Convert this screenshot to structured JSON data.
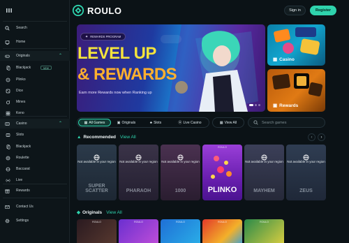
{
  "app": {
    "logo_text": "ROULO"
  },
  "header": {
    "signin_label": "Sign in",
    "register_label": "Register"
  },
  "sidebar": {
    "top": [
      {
        "label": "Search",
        "icon": "search-icon"
      },
      {
        "label": "Home",
        "icon": "home-icon"
      }
    ],
    "originals": {
      "label": "Originals",
      "icon": "gamepad-icon",
      "items": [
        {
          "label": "Blackjack",
          "badge": "NEW"
        },
        {
          "label": "Plinko"
        },
        {
          "label": "Dice"
        },
        {
          "label": "Mines"
        },
        {
          "label": "Keno"
        }
      ]
    },
    "casino": {
      "label": "Casino",
      "icon": "casino-icon",
      "items": [
        {
          "label": "Slots"
        },
        {
          "label": "Blackjack"
        },
        {
          "label": "Roulette"
        },
        {
          "label": "Baccarat"
        },
        {
          "label": "Live"
        }
      ]
    },
    "rewards": {
      "label": "Rewards"
    },
    "contact": {
      "label": "Contact Us"
    },
    "settings": {
      "label": "Settings"
    }
  },
  "hero": {
    "pill": "REWARDS PROGRAM",
    "title_line1": "LEVEL UP",
    "title_line2": "& REWARDS",
    "subtitle": "Earn more Rewards now when Ranking up"
  },
  "side_cards": {
    "casino": "Casino",
    "rewards": "Rewards"
  },
  "tabs": [
    {
      "label": "All Games",
      "active": true
    },
    {
      "label": "Originals",
      "active": false
    },
    {
      "label": "Slots",
      "active": false
    },
    {
      "label": "Live Casino",
      "active": false
    }
  ],
  "view_all_button": "View All",
  "search": {
    "placeholder": "Search games"
  },
  "recommended": {
    "title": "Recommended",
    "view_all": "View All",
    "games": [
      {
        "name": "SUPER SCATTER",
        "status": "Not available in your region",
        "tag": ""
      },
      {
        "name": "PHARAOH",
        "status": "Not available in your region",
        "tag": ""
      },
      {
        "name": "1000",
        "status": "Not available in your region",
        "tag": ""
      },
      {
        "name": "PLINKO",
        "status": "",
        "tag": "ROULO"
      },
      {
        "name": "MAYHEM",
        "status": "Not available in your region",
        "tag": ""
      },
      {
        "name": "ZEUS",
        "status": "Not available in your region",
        "tag": ""
      }
    ]
  },
  "originals": {
    "title": "Originals",
    "view_all": "View All",
    "tags": [
      "ROULO",
      "ROULO",
      "ROULO",
      "ROULO",
      "ROULO"
    ]
  },
  "colors": {
    "accent": "#2fd3ad",
    "background": "#0b1216",
    "sidebar": "#0d1519"
  }
}
